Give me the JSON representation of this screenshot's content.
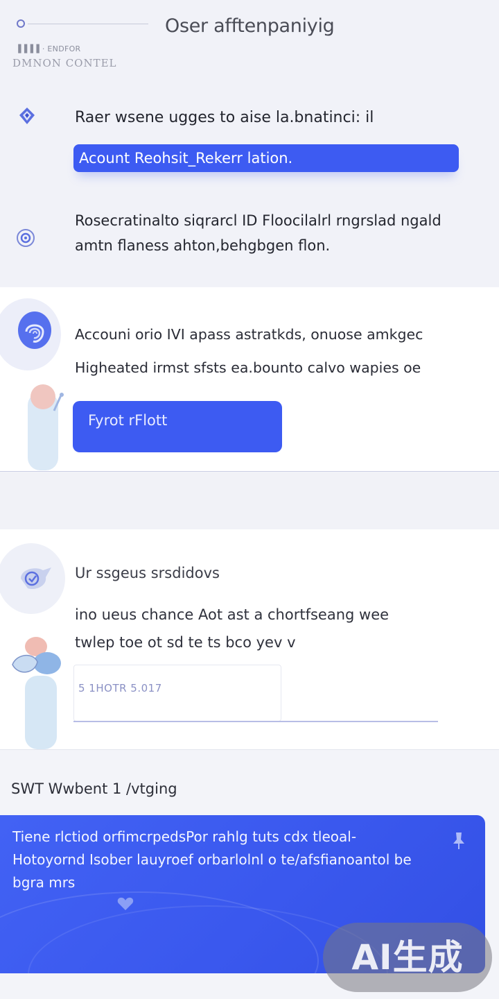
{
  "header": {
    "logo_small": "▐▐▐▐ · ENDFOR",
    "logo_caption": "DMNON CONTEL",
    "title": "Oser afftenpaniyig",
    "line1": "Raer wsene ugges to aise la.bnatinci: il",
    "pill_label": "Acount Reohsit_Rekerr lation.",
    "paragraph": "Rosecratinalto siqrarcl ID Floocilalrl rngrslad ngald amtn flaness  ahton,behgbgen flon."
  },
  "section2": {
    "line1": "Accouni orio IVI apass astratkds, onuose amkgec",
    "line2": "Higheated irmst sfsts ea.bounto calvo wapies oe",
    "button_label": "Fyrot rFlott"
  },
  "section3": {
    "title": "Ur ssgeus srsdidovs",
    "line1": "ino ueus chance Aot ast a  chortfseang wee",
    "line2": "twlep toe ot sd te ts bco yev v",
    "field_value": "5 1HOTR 5.017"
  },
  "bottom": {
    "heading": "SWT Wwbent   1 /vtging",
    "paragraph": "Tiene rlctiod orfimcrpedsPor rahlg tuts cdx tleoal-Hotoyornd Isober lauyroef orbarlolnl o te/afsfianoantol be bgra mrs"
  },
  "watermark": "AI生成",
  "colors": {
    "accent": "#3d5bf2",
    "background": "#f3f4f9",
    "card": "#ffffff"
  },
  "icons": [
    "shield-icon",
    "at-sign-icon",
    "fingerprint-icon",
    "lock-badge-icon",
    "pin-icon",
    "heart-icon"
  ]
}
